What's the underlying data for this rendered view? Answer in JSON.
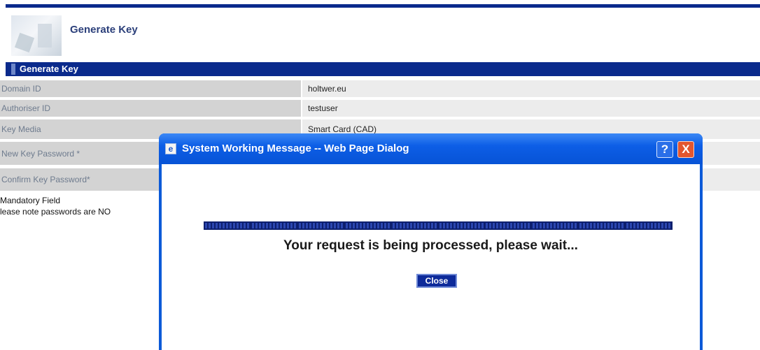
{
  "header": {
    "title": "Generate Key"
  },
  "section": {
    "title": "Generate Key"
  },
  "form": {
    "rows": [
      {
        "label": "Domain ID",
        "value": "holtwer.eu"
      },
      {
        "label": "Authoriser ID",
        "value": "testuser"
      },
      {
        "label": "Key Media",
        "value": "Smart Card (CAD)"
      },
      {
        "label": "New Key Password *",
        "value": ""
      },
      {
        "label": "Confirm Key Password*",
        "value": ""
      }
    ],
    "note_mandatory": "Mandatory Field",
    "note_passwords": "lease note passwords are NO"
  },
  "dialog": {
    "title": "System Working Message -- Web Page Dialog",
    "help_icon": "?",
    "close_icon": "X",
    "message": "Your request is being processed, please wait...",
    "close_label": "Close"
  },
  "colors": {
    "accent": "#0a2a8c",
    "dialog_titlebar": "#0753d6",
    "label_bg": "#d3d3d3",
    "value_bg": "#ececec"
  }
}
